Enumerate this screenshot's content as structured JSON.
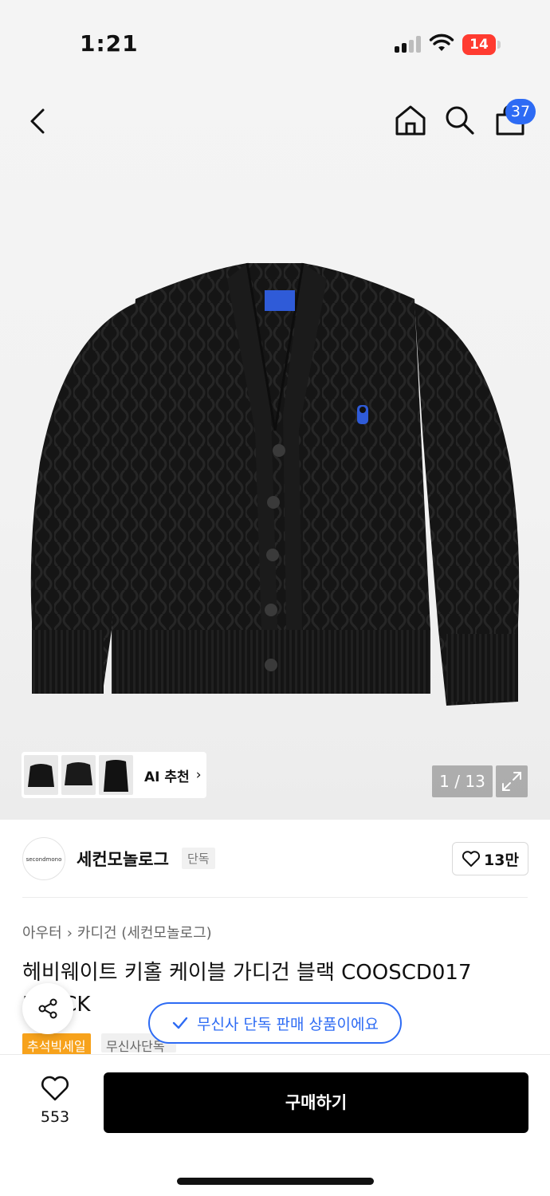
{
  "status_bar": {
    "time": "1:21",
    "battery": "14"
  },
  "nav": {
    "cart_count": "37",
    "icons": [
      "back-icon",
      "home-icon",
      "search-icon",
      "shopping-bag-icon"
    ]
  },
  "gallery": {
    "counter": "1 / 13",
    "ai_recommend_label": "AI 추천",
    "ai_recommend_chevron": "›"
  },
  "brand": {
    "logo_text": "secondmono",
    "name": "세컨모놀로그",
    "tag": "단독",
    "like_count": "13만"
  },
  "breadcrumb": {
    "level1": "아우터",
    "separator": "›",
    "level2": "카디건 (세컨모놀로그)"
  },
  "product": {
    "title": "헤비웨이트 키홀 케이블 가디건 블랙 COOSCD017 BLACK",
    "title_line1": "헤비웨이트 키홀 케이블 가디건 블랙 COOSCD017",
    "title_line2": "BLACK"
  },
  "badges": {
    "sale": "추석빅세일",
    "exclusive": "무신사단독"
  },
  "toast": {
    "message": "무신사 단독 판매 상품이에요"
  },
  "bottom": {
    "wish_count": "553",
    "buy_label": "구매하기"
  },
  "colors": {
    "accent": "#2d6bf4",
    "sale": "#f7a21b",
    "buy_button": "#000000"
  }
}
